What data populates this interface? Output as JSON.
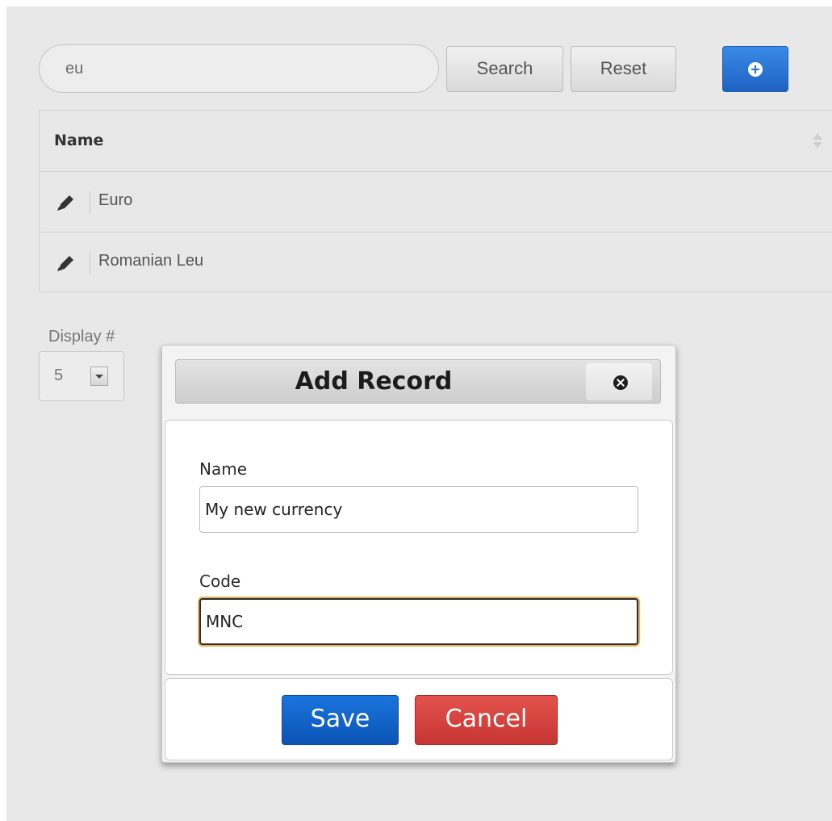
{
  "search": {
    "value": "eu",
    "search_label": "Search",
    "reset_label": "Reset"
  },
  "table": {
    "columns": [
      "Name"
    ],
    "rows": [
      {
        "name": "Euro"
      },
      {
        "name": "Romanian Leu"
      }
    ]
  },
  "pagination": {
    "display_label": "Display #",
    "page_size": "5"
  },
  "modal": {
    "title": "Add Record",
    "fields": {
      "name": {
        "label": "Name",
        "value": "My new currency"
      },
      "code": {
        "label": "Code",
        "value": "MNC"
      }
    },
    "save_label": "Save",
    "cancel_label": "Cancel"
  },
  "colors": {
    "primary": "#1f62c3",
    "danger": "#c63531",
    "focus_ring": "#e7b35a"
  }
}
